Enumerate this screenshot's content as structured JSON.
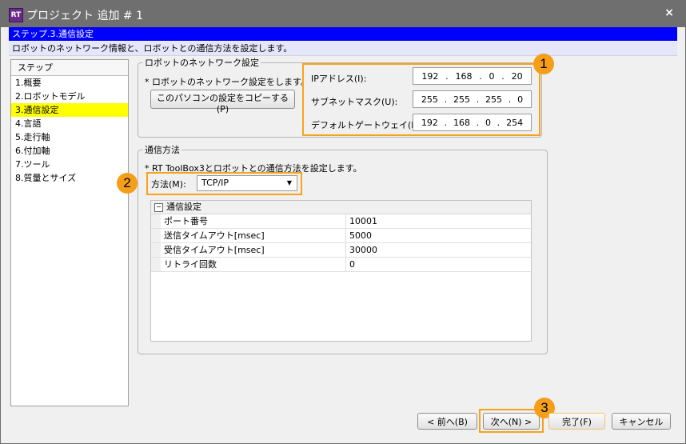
{
  "window": {
    "title": "プロジェクト 追加 # 1",
    "app_icon": "RT",
    "close_label": "×"
  },
  "step_header": "ステップ.3.通信設定",
  "description": "ロボットのネットワーク情報と、ロボットとの通信方法を設定します。",
  "steps": {
    "header": "ステップ",
    "items": [
      "1.概要",
      "2.ロボットモデル",
      "3.通信設定",
      "4.言語",
      "5.走行軸",
      "6.付加軸",
      "7.ツール",
      "8.質量とサイズ"
    ],
    "active_index": 2,
    "active_color": "#ffff00"
  },
  "network": {
    "legend": "ロボットのネットワーク設定",
    "note": "* ロボットのネットワーク設定をします。",
    "copy_button": "このパソコンの設定をコピーする(P)",
    "ip_label": "IPアドレス(I):",
    "ip": [
      "192",
      "168",
      "0",
      "20"
    ],
    "subnet_label": "サブネットマスク(U):",
    "subnet": [
      "255",
      "255",
      "255",
      "0"
    ],
    "gateway_label": "デフォルトゲートウェイ(D):",
    "gateway": [
      "192",
      "168",
      "0",
      "254"
    ],
    "ip_sep": "."
  },
  "comm": {
    "legend": "通信方法",
    "note": "* RT ToolBox3とロボットとの通信方法を設定します。",
    "method_label": "方法(M):",
    "method_value": "TCP/IP",
    "group_title": "通信設定",
    "group_toggle": "−",
    "rows": [
      {
        "name": "ポート番号",
        "value": "10001"
      },
      {
        "name": "送信タイムアウト[msec]",
        "value": "5000"
      },
      {
        "name": "受信タイムアウト[msec]",
        "value": "30000"
      },
      {
        "name": "リトライ回数",
        "value": "0"
      }
    ]
  },
  "buttons": {
    "back": "< 前へ(B)",
    "next": "次へ(N) >",
    "finish": "完了(F)",
    "cancel": "キャンセル"
  },
  "badges": [
    "1",
    "2",
    "3"
  ],
  "colors": {
    "highlight": "#f7a21b",
    "step_bar": "#0000ff",
    "active_step": "#ffff00"
  }
}
